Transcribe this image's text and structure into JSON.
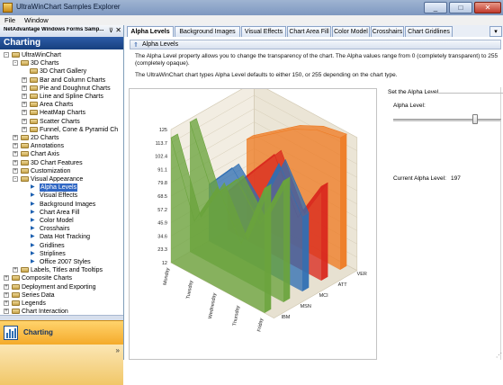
{
  "window": {
    "title": "UltraWinChart Samples Explorer",
    "minimize": "_",
    "maximize": "□",
    "close": "✕"
  },
  "menu": {
    "items": [
      "File",
      "Window"
    ]
  },
  "left_panel": {
    "doc_tab": "NetAdvantage Windows Forms Samp...",
    "pin": "⊽",
    "close": "✕",
    "header": "Charting",
    "tree": [
      {
        "label": "UltraWinChart",
        "level": 0,
        "expander": "-",
        "icon": "folder-icon"
      },
      {
        "label": "3D Charts",
        "level": 1,
        "expander": "-",
        "icon": "folder-icon"
      },
      {
        "label": "3D Chart Gallery",
        "level": 2,
        "expander": "",
        "icon": "folder-icon"
      },
      {
        "label": "Bar and Column Charts",
        "level": 2,
        "expander": "+",
        "icon": "folder-icon"
      },
      {
        "label": "Pie and Doughnut Charts",
        "level": 2,
        "expander": "+",
        "icon": "folder-icon"
      },
      {
        "label": "Line and Spline Charts",
        "level": 2,
        "expander": "+",
        "icon": "folder-icon"
      },
      {
        "label": "Area Charts",
        "level": 2,
        "expander": "+",
        "icon": "folder-icon"
      },
      {
        "label": "HeatMap Charts",
        "level": 2,
        "expander": "+",
        "icon": "folder-icon"
      },
      {
        "label": "Scatter Charts",
        "level": 2,
        "expander": "+",
        "icon": "folder-icon"
      },
      {
        "label": "Funnel, Cone & Pyramid Ch",
        "level": 2,
        "expander": "+",
        "icon": "folder-icon"
      },
      {
        "label": "2D Charts",
        "level": 1,
        "expander": "+",
        "icon": "folder-icon"
      },
      {
        "label": "Annotations",
        "level": 1,
        "expander": "+",
        "icon": "folder-icon"
      },
      {
        "label": "Chart Axis",
        "level": 1,
        "expander": "+",
        "icon": "folder-icon"
      },
      {
        "label": "3D Chart Features",
        "level": 1,
        "expander": "+",
        "icon": "folder-icon"
      },
      {
        "label": "Customization",
        "level": 1,
        "expander": "+",
        "icon": "folder-icon"
      },
      {
        "label": "Visual Appearance",
        "level": 1,
        "expander": "-",
        "icon": "folder-icon"
      },
      {
        "label": "Alpha Levels",
        "level": 2,
        "expander": "",
        "icon": "arrow-icon",
        "selected": true
      },
      {
        "label": "Visual Effects",
        "level": 2,
        "expander": "",
        "icon": "arrow-icon"
      },
      {
        "label": "Background Images",
        "level": 2,
        "expander": "",
        "icon": "arrow-icon"
      },
      {
        "label": "Chart Area Fill",
        "level": 2,
        "expander": "",
        "icon": "arrow-icon"
      },
      {
        "label": "Color Model",
        "level": 2,
        "expander": "",
        "icon": "arrow-icon"
      },
      {
        "label": "Crosshairs",
        "level": 2,
        "expander": "",
        "icon": "arrow-icon"
      },
      {
        "label": "Data Hot Tracking",
        "level": 2,
        "expander": "",
        "icon": "arrow-icon"
      },
      {
        "label": "Gridlines",
        "level": 2,
        "expander": "",
        "icon": "arrow-icon"
      },
      {
        "label": "Striplines",
        "level": 2,
        "expander": "",
        "icon": "arrow-icon"
      },
      {
        "label": "Office 2007 Styles",
        "level": 2,
        "expander": "",
        "icon": "arrow-icon"
      },
      {
        "label": "Labels, Titles and Tooltips",
        "level": 1,
        "expander": "+",
        "icon": "folder-icon"
      },
      {
        "label": "Composite Charts",
        "level": 0,
        "expander": "+",
        "icon": "folder-icon"
      },
      {
        "label": "Deployment and Exporting",
        "level": 0,
        "expander": "+",
        "icon": "folder-icon"
      },
      {
        "label": "Series Data",
        "level": 0,
        "expander": "+",
        "icon": "folder-icon"
      },
      {
        "label": "Legends",
        "level": 0,
        "expander": "+",
        "icon": "folder-icon"
      },
      {
        "label": "Chart Interaction",
        "level": 0,
        "expander": "+",
        "icon": "folder-icon"
      }
    ],
    "bottom_button": "Charting"
  },
  "tabs": {
    "items": [
      "Alpha Levels",
      "Background Images",
      "Visual Effects",
      "Chart Area Fill",
      "Color Model",
      "Crosshairs",
      "Chart Gridlines"
    ],
    "active": 0,
    "more": "▾"
  },
  "content": {
    "section_title": "Alpha Levels",
    "para1a": "The Alpha Level property allows you to change the transparency of the chart.  The Alpha values range from 0 (completely transparent) to 255",
    "para1b": "(completely opaque).",
    "para2": "The UltraWinChart chart types Alpha Level defaults to either 150, or 255 depending on the chart type.",
    "group_title": "Set the Alpha Level",
    "alpha_label": "Alpha Level:",
    "alpha_value": 197,
    "alpha_max": 255,
    "current_label": "Current Alpha Level:",
    "current_value": "197"
  },
  "colors": {
    "green": "#6aa33c",
    "orange": "#ee7a22",
    "red": "#d9281e",
    "blue": "#2f6fb3",
    "header_blue": "#1f4d93"
  },
  "chart_data": {
    "type": "area",
    "title": "",
    "y_ticks": [
      "12",
      "23.3",
      "34.6",
      "45.9",
      "57.2",
      "68.5",
      "79.8",
      "91.1",
      "102.4",
      "113.7",
      "125"
    ],
    "x_categories": [
      "Monday",
      "Tuesday",
      "Wednesday",
      "Thursday",
      "Friday"
    ],
    "z_series": [
      "IBM",
      "MSN",
      "MCI",
      "ATT",
      "VER"
    ],
    "ylim": [
      12,
      125
    ],
    "series": [
      {
        "name": "IBM",
        "color": "#6aa33c",
        "values": [
          118,
          58,
          98,
          60,
          118
        ]
      },
      {
        "name": "MSN",
        "color": "#6aa33c",
        "values": [
          122,
          70,
          95,
          68,
          115
        ]
      },
      {
        "name": "MCI",
        "color": "#2f6fb3",
        "values": [
          60,
          85,
          62,
          110,
          75
        ]
      },
      {
        "name": "ATT",
        "color": "#d9281e",
        "values": [
          45,
          72,
          98,
          55,
          92
        ]
      },
      {
        "name": "VER",
        "color": "#ee7a22",
        "values": [
          80,
          95,
          110,
          120,
          124
        ]
      }
    ]
  }
}
